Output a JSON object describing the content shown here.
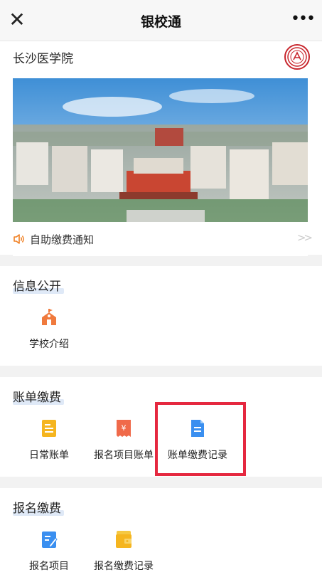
{
  "topbar": {
    "title": "银校通",
    "close_icon": "close-icon",
    "more_icon": "more-icon"
  },
  "school": {
    "name": "长沙医学院"
  },
  "notice": {
    "text": "自助缴费通知",
    "arrow": ">>"
  },
  "sections": [
    {
      "title": "信息公开",
      "items": [
        {
          "label": "学校介绍",
          "icon": "school-icon"
        }
      ]
    },
    {
      "title": "账单缴费",
      "items": [
        {
          "label": "日常账单",
          "icon": "daily-bill-icon"
        },
        {
          "label": "报名项目账单",
          "icon": "registration-bill-icon"
        },
        {
          "label": "账单缴费记录",
          "icon": "bill-record-icon"
        }
      ]
    },
    {
      "title": "报名缴费",
      "items": [
        {
          "label": "报名项目",
          "icon": "registration-item-icon"
        },
        {
          "label": "报名缴费记录",
          "icon": "registration-record-icon"
        }
      ]
    }
  ],
  "colors": {
    "accent_red": "#e5283f",
    "orange": "#f5a623",
    "blue": "#3a8ff0"
  }
}
